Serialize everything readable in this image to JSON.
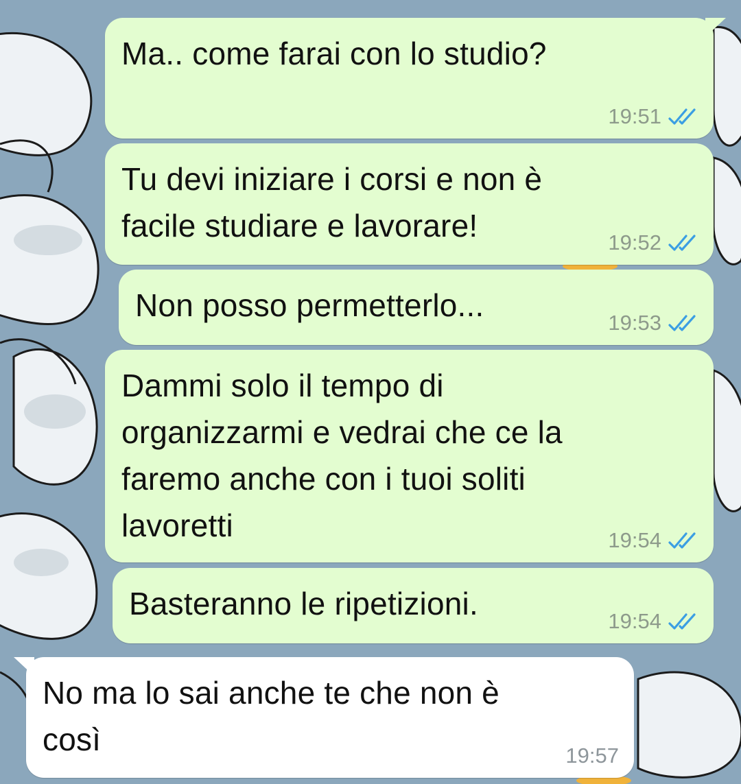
{
  "colors": {
    "outgoing_bubble": "#e3fdd0",
    "incoming_bubble": "#ffffff",
    "read_ticks": "#3b9ee3",
    "wallpaper": "#8aa6bb"
  },
  "icons": {
    "read_receipt": "double-check-icon"
  },
  "messages": [
    {
      "direction": "outgoing",
      "text": "Ma.. come farai con lo studio?",
      "time": "19:51",
      "status": "read"
    },
    {
      "direction": "outgoing",
      "text": "Tu devi iniziare i corsi e non è\nfacile studiare e lavorare!",
      "time": "19:52",
      "status": "read"
    },
    {
      "direction": "outgoing",
      "text": "Non posso permetterlo...",
      "time": "19:53",
      "status": "read"
    },
    {
      "direction": "outgoing",
      "text": "Dammi solo il tempo di\norganizzarmi e vedrai che ce la\nfaremo anche con i tuoi soliti\nlavoretti",
      "time": "19:54",
      "status": "read"
    },
    {
      "direction": "outgoing",
      "text": "Basteranno le ripetizioni.",
      "time": "19:54",
      "status": "read"
    },
    {
      "direction": "incoming",
      "text": "No ma lo sai anche te che non è\ncosì",
      "time": "19:57"
    }
  ]
}
